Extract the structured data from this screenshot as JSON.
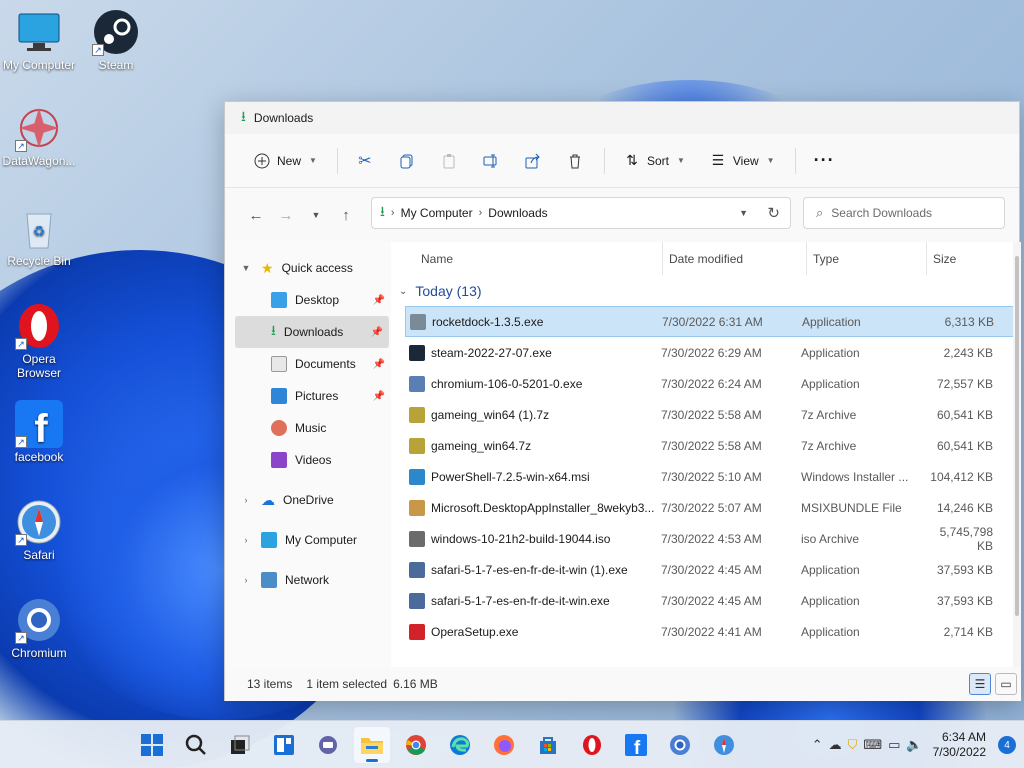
{
  "desktop": {
    "icons": [
      {
        "label": "My Computer",
        "icon": "monitor-icon"
      },
      {
        "label": "Steam",
        "icon": "steam-icon"
      },
      {
        "label": "DataWagon...",
        "icon": "datawagon-icon"
      },
      {
        "label": "Recycle Bin",
        "icon": "recycle-bin-icon"
      },
      {
        "label": "Opera Browser",
        "icon": "opera-icon"
      },
      {
        "label": "facebook",
        "icon": "facebook-icon"
      },
      {
        "label": "Safari",
        "icon": "safari-icon"
      },
      {
        "label": "Chromium",
        "icon": "chromium-icon"
      }
    ]
  },
  "window": {
    "title": "Downloads",
    "toolbar": {
      "new_label": "New",
      "sort_label": "Sort",
      "view_label": "View",
      "more_label": "···"
    },
    "address": {
      "crumbs": [
        "My Computer",
        "Downloads"
      ]
    },
    "search": {
      "placeholder": "Search Downloads"
    },
    "nav": {
      "quick_access": "Quick access",
      "items": [
        "Desktop",
        "Downloads",
        "Documents",
        "Pictures",
        "Music",
        "Videos"
      ],
      "onedrive": "OneDrive",
      "mycomputer": "My Computer",
      "network": "Network"
    },
    "columns": {
      "name": "Name",
      "date": "Date modified",
      "type": "Type",
      "size": "Size"
    },
    "group_label": "Today (13)",
    "files": [
      {
        "name": "rocketdock-1.3.5.exe",
        "date": "7/30/2022 6:31 AM",
        "type": "Application",
        "size": "6,313 KB",
        "color": "#7b8a99"
      },
      {
        "name": "steam-2022-27-07.exe",
        "date": "7/30/2022 6:29 AM",
        "type": "Application",
        "size": "2,243 KB",
        "color": "#1b2838"
      },
      {
        "name": "chromium-106-0-5201-0.exe",
        "date": "7/30/2022 6:24 AM",
        "type": "Application",
        "size": "72,557 KB",
        "color": "#5a7fb5"
      },
      {
        "name": "gameing_win64 (1).7z",
        "date": "7/30/2022 5:58 AM",
        "type": "7z Archive",
        "size": "60,541 KB",
        "color": "#b7a33a"
      },
      {
        "name": "gameing_win64.7z",
        "date": "7/30/2022 5:58 AM",
        "type": "7z Archive",
        "size": "60,541 KB",
        "color": "#b7a33a"
      },
      {
        "name": "PowerShell-7.2.5-win-x64.msi",
        "date": "7/30/2022 5:10 AM",
        "type": "Windows Installer ...",
        "size": "104,412 KB",
        "color": "#2b88c9"
      },
      {
        "name": "Microsoft.DesktopAppInstaller_8wekyb3...",
        "date": "7/30/2022 5:07 AM",
        "type": "MSIXBUNDLE File",
        "size": "14,246 KB",
        "color": "#c8974a"
      },
      {
        "name": "windows-10-21h2-build-19044.iso",
        "date": "7/30/2022 4:53 AM",
        "type": "iso Archive",
        "size": "5,745,798 KB",
        "color": "#6b6b6b"
      },
      {
        "name": "safari-5-1-7-es-en-fr-de-it-win (1).exe",
        "date": "7/30/2022 4:45 AM",
        "type": "Application",
        "size": "37,593 KB",
        "color": "#4b6b9b"
      },
      {
        "name": "safari-5-1-7-es-en-fr-de-it-win.exe",
        "date": "7/30/2022 4:45 AM",
        "type": "Application",
        "size": "37,593 KB",
        "color": "#4b6b9b"
      },
      {
        "name": "OperaSetup.exe",
        "date": "7/30/2022 4:41 AM",
        "type": "Application",
        "size": "2,714 KB",
        "color": "#d2232a"
      }
    ],
    "status": {
      "items": "13 items",
      "selected": "1 item selected",
      "size": "6.16 MB"
    }
  },
  "taskbar": {
    "apps": [
      "start-icon",
      "search-icon",
      "task-view-icon",
      "widgets-icon",
      "chat-icon",
      "file-explorer-icon",
      "chrome-icon",
      "edge-icon",
      "firefox-icon",
      "store-icon",
      "opera-icon",
      "facebook-icon",
      "chromium-icon",
      "safari-icon"
    ],
    "time": "6:34 AM",
    "date": "7/30/2022",
    "notifications": "4"
  },
  "colors": {
    "accent": "#1a6fd6",
    "selection": "#cce4f7",
    "download_green": "#1f9d55"
  }
}
